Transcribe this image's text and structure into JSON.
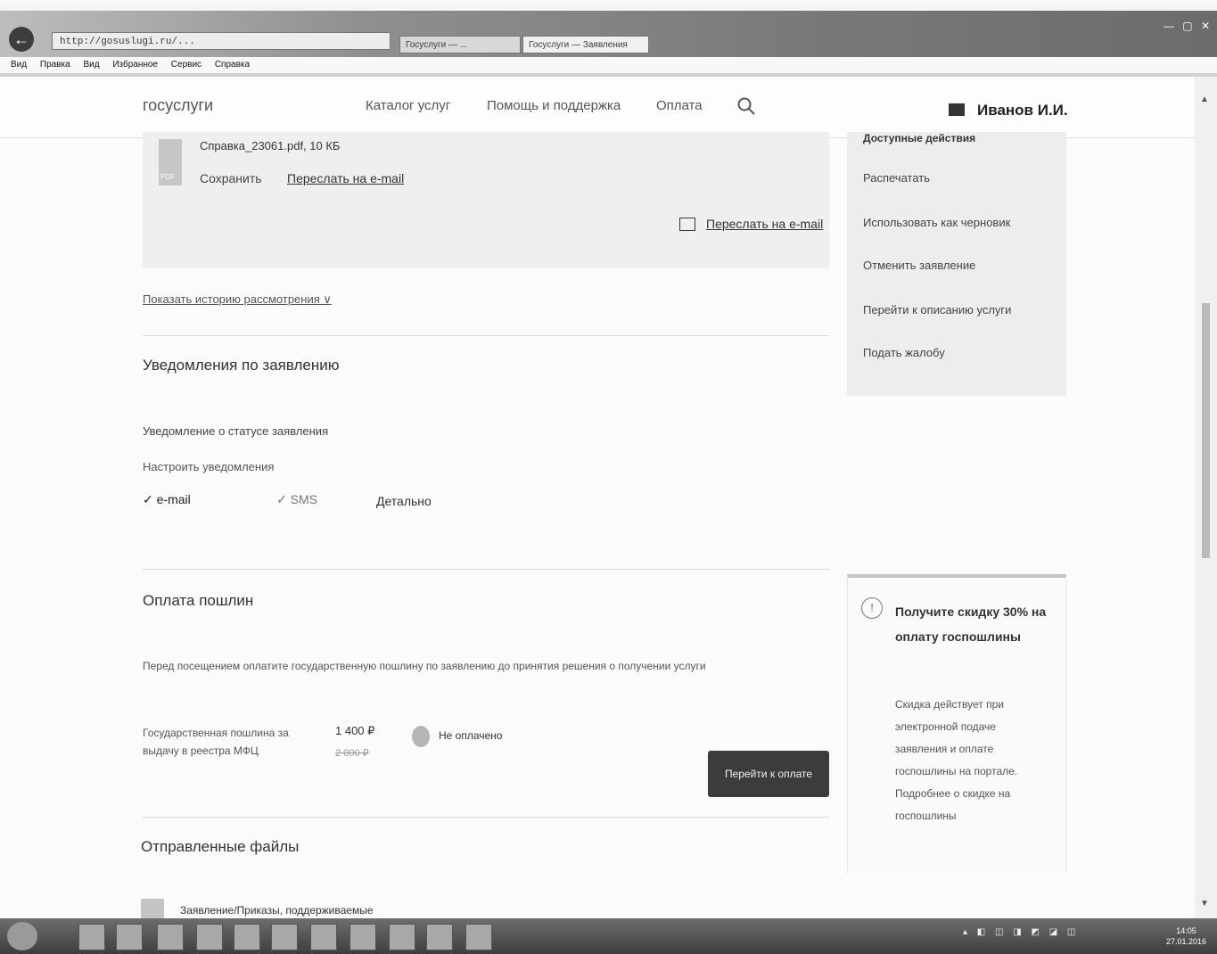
{
  "browser": {
    "back": "←",
    "address": "http://gosuslugi.ru/...",
    "tabs": [
      "Госуслуги — ...",
      "Госуслуги — Заявления"
    ],
    "window_controls": "— ▢ ✕",
    "menu": [
      "Вид",
      "Правка",
      "Вид",
      "Избранное",
      "Сервис",
      "Справка"
    ]
  },
  "header": {
    "logo": "госуслуги",
    "nav": [
      "Каталог услуг",
      "Помощь и поддержка",
      "Оплата"
    ],
    "user_name": "Иванов И.И."
  },
  "file": {
    "name": "Справка_23061.pdf, 10 КБ",
    "type_tag": "PDF",
    "save_label": "Сохранить",
    "email_label": "Переслать на e-mail",
    "resend_label": "Переслать на e-mail"
  },
  "history_toggle": "Показать историю рассмотрения ∨",
  "notifications": {
    "heading": "Уведомления по заявлению",
    "status_label": "Уведомление о статусе заявления",
    "settings_label": "Настроить уведомления",
    "channel_email": "✓ e-mail",
    "channel_2": "✓ SMS",
    "details": "Детально"
  },
  "payment": {
    "heading": "Оплата пошлин",
    "note": "Перед посещением оплатите государственную пошлину по заявлению до принятия решения о получении услуги",
    "fee_name": "Государственная пошлина за выдачу в реестра МФЦ",
    "amount": "1 400 ₽",
    "old_amount": "2 000 ₽",
    "status": "Не оплачено",
    "pay_button": "Перейти к оплате"
  },
  "sent_files": {
    "heading": "Отправленные файлы",
    "file_name": "Заявление/Приказы, поддерживаемые"
  },
  "sidebar": {
    "actions_title": "Доступные действия",
    "actions": [
      "Распечатать",
      "Использовать как черновик",
      "Отменить заявление",
      "Перейти к описанию услуги",
      "Подать жалобу"
    ],
    "discount_icon": "!",
    "discount_title": "Получите скидку 30% на оплату госпошлины",
    "discount_text": "Скидка действует при электронной подаче заявления и оплате госпошлины на портале. Подробнее о скидке на госпошлины"
  },
  "scrollbar": {
    "up": "▲",
    "down": "▼"
  },
  "taskbar": {
    "tray": "▴ ◧ ◫ ◨ ◩ ◪ ◫",
    "clock": "14:05\n27.01.2016"
  }
}
